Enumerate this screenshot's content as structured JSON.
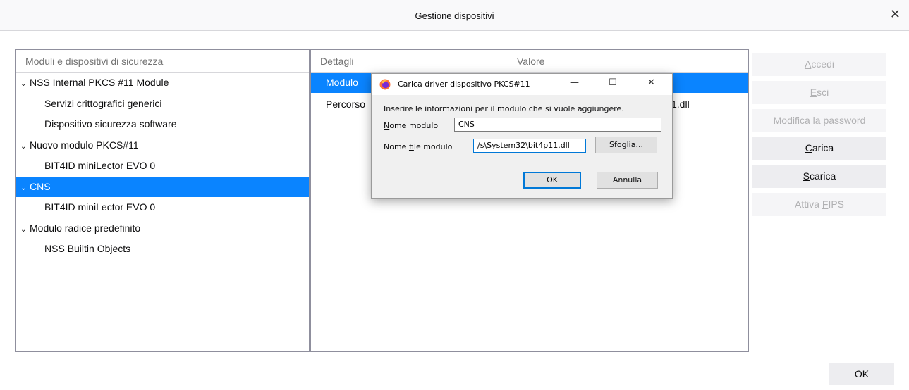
{
  "window": {
    "title": "Gestione dispositivi",
    "close_glyph": "✕"
  },
  "tree": {
    "header": "Moduli e dispositivi di sicurezza",
    "rows": [
      {
        "label": "NSS Internal PKCS #11 Module",
        "level": 0,
        "expanded": true
      },
      {
        "label": "Servizi crittografici generici",
        "level": 1
      },
      {
        "label": "Dispositivo sicurezza software",
        "level": 1
      },
      {
        "label": "Nuovo modulo PKCS#11",
        "level": 0,
        "expanded": true
      },
      {
        "label": "BIT4ID miniLector EVO 0",
        "level": 1
      },
      {
        "label": "CNS",
        "level": 0,
        "expanded": true,
        "selected": true
      },
      {
        "label": "BIT4ID miniLector EVO 0",
        "level": 1
      },
      {
        "label": "Modulo radice predefinito",
        "level": 0,
        "expanded": true
      },
      {
        "label": "NSS Builtin Objects",
        "level": 1
      }
    ],
    "twisty_glyph": "⌄"
  },
  "details": {
    "col_details": "Dettagli",
    "col_value": "Valore",
    "rows": [
      {
        "label": "Modulo",
        "value": "",
        "selected": true
      },
      {
        "label": "Percorso",
        "value": "1.dll"
      }
    ]
  },
  "side_buttons": {
    "login": "Accedi",
    "logout": "Esci",
    "change_password": "Modifica la password",
    "load": "Carica",
    "unload": "Scarica",
    "fips": "Attiva FIPS"
  },
  "ok_label": "OK",
  "dialog": {
    "title": "Carica driver dispositivo PKCS#11",
    "prompt": "Inserire le informazioni per il modulo che si vuole aggiungere.",
    "name_label": "Nome modulo",
    "name_value": "CNS",
    "file_label": "Nome file modulo",
    "file_value": "/s\\System32\\bit4p11.dll",
    "browse_label": "Sfoglia...",
    "ok_label": "OK",
    "cancel_label": "Annulla"
  }
}
